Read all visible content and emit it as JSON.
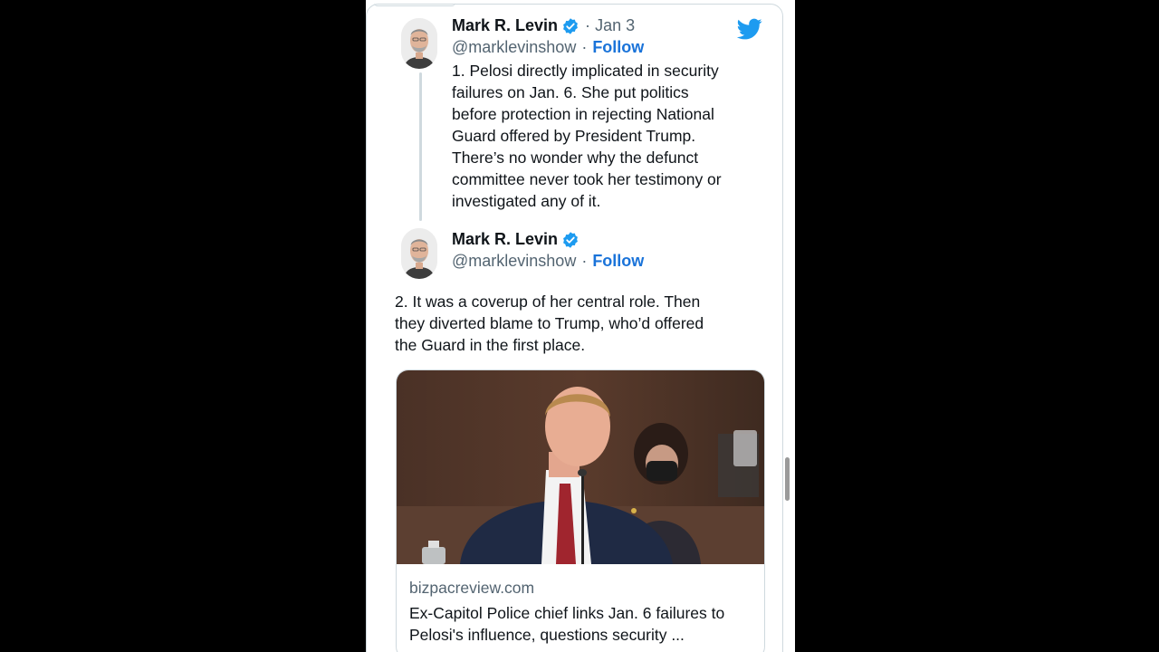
{
  "tweets": [
    {
      "name": "Mark R. Levin",
      "date": "Jan 3",
      "handle": "@marklevinshow",
      "separator": "·",
      "follow": "Follow",
      "text": "1. Pelosi directly implicated in security\nfailures on Jan. 6.  She put politics\nbefore protection in rejecting National\nGuard offered by President Trump.\nThere’s no wonder why the defunct\ncommittee never took her testimony or\ninvestigated any of it."
    },
    {
      "name": "Mark R. Levin",
      "handle": "@marklevinshow",
      "separator": "·",
      "follow": "Follow",
      "text": "2. It was a coverup of her central role. Then\nthey diverted blame to Trump, who’d offered\nthe Guard in the first place."
    }
  ],
  "link_card": {
    "domain": "bizpacreview.com",
    "title": "Ex-Capitol Police chief links Jan. 6 failures to Pelosi's influence, questions security ..."
  },
  "icons": {
    "brand": "twitter-bird-icon",
    "verified": "verified-badge-icon"
  },
  "colors": {
    "brand_blue": "#1d9bf0",
    "follow_blue": "#1a73d9",
    "text": "#0f1419",
    "muted": "#536471",
    "border": "#cfd9de",
    "background_bars": "#000000"
  }
}
